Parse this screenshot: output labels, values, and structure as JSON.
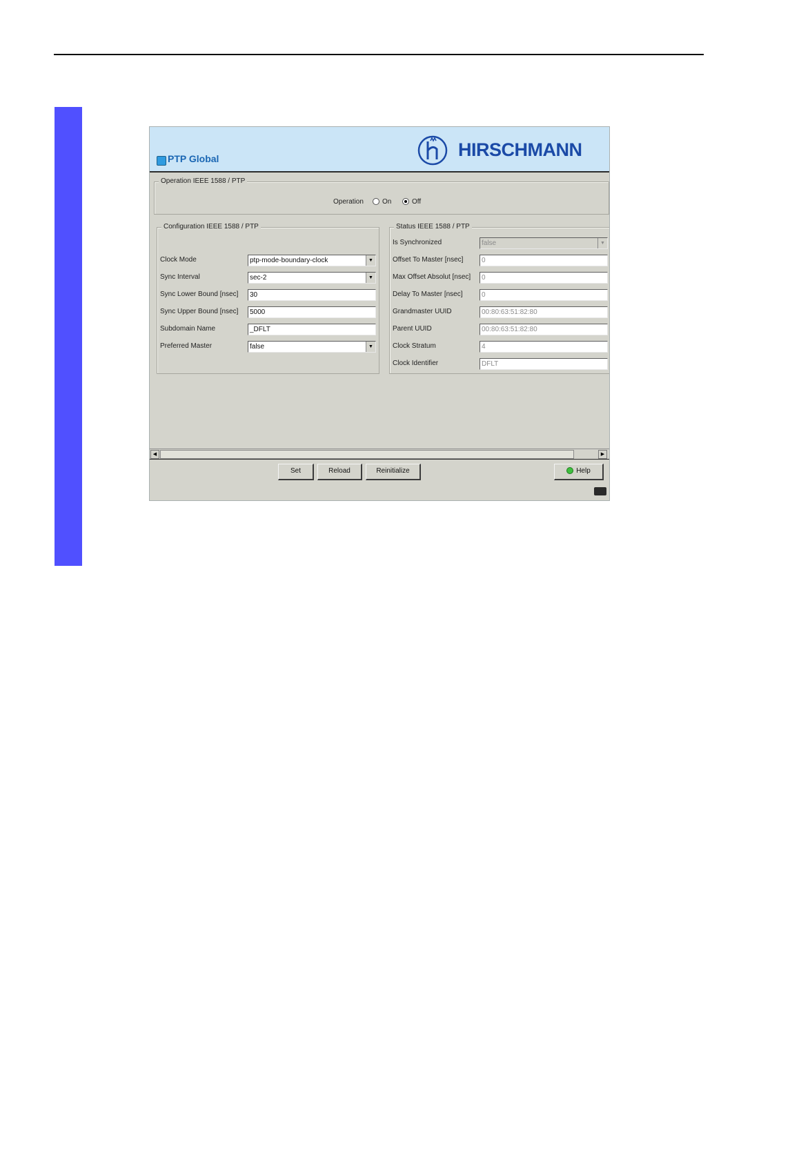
{
  "header": {
    "title": "PTP Global",
    "brand": "HIRSCHMANN"
  },
  "operation_group": {
    "legend": "Operation IEEE 1588 / PTP",
    "label": "Operation",
    "options": [
      {
        "label": "On",
        "selected": false
      },
      {
        "label": "Off",
        "selected": true
      }
    ]
  },
  "config": {
    "legend": "Configuration IEEE 1588 / PTP",
    "clock_mode": {
      "label": "Clock Mode",
      "value": "ptp-mode-boundary-clock"
    },
    "sync_interval": {
      "label": "Sync Interval",
      "value": "sec-2"
    },
    "sync_lower": {
      "label": "Sync Lower Bound [nsec]",
      "value": "30"
    },
    "sync_upper": {
      "label": "Sync Upper Bound [nsec]",
      "value": "5000"
    },
    "subdomain": {
      "label": "Subdomain Name",
      "value": "_DFLT"
    },
    "preferred_master": {
      "label": "Preferred Master",
      "value": "false"
    }
  },
  "status": {
    "legend": "Status IEEE 1588 / PTP",
    "is_synchronized": {
      "label": "Is Synchronized",
      "value": "false"
    },
    "offset_to_master": {
      "label": "Offset To Master [nsec]",
      "value": "0"
    },
    "max_offset": {
      "label": "Max Offset Absolut [nsec]",
      "value": "0"
    },
    "delay_to_master": {
      "label": "Delay To Master [nsec]",
      "value": "0"
    },
    "grandmaster_uuid": {
      "label": "Grandmaster UUID",
      "value": "00:80:63:51:82:80"
    },
    "parent_uuid": {
      "label": "Parent UUID",
      "value": "00:80:63:51:82:80"
    },
    "clock_stratum": {
      "label": "Clock Stratum",
      "value": "4"
    },
    "clock_identifier": {
      "label": "Clock Identifier",
      "value": "DFLT"
    }
  },
  "buttons": {
    "set": "Set",
    "reload": "Reload",
    "reinitialize": "Reinitialize",
    "help": "Help"
  },
  "colors": {
    "side_bar": "#5050ff",
    "header_bg": "#cbe5f7",
    "brand": "#1b4aa7",
    "panel_bg": "#d4d4cc"
  },
  "icons": {
    "title": "ptp-global-icon",
    "logo": "hirschmann-logo-icon",
    "help": "help-icon"
  }
}
